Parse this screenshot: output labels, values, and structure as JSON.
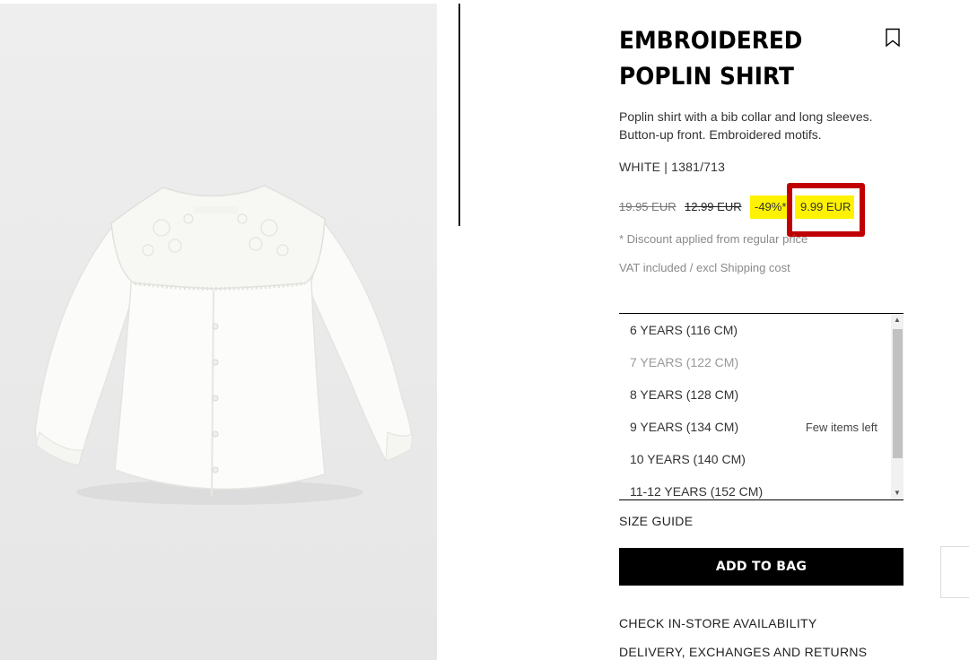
{
  "product": {
    "title_line1": "EMBROIDERED",
    "title_line2": "POPLIN SHIRT",
    "description_line1": "Poplin shirt with a bib collar and long sleeves.",
    "description_line2": "Button-up front. Embroidered motifs.",
    "color_ref": "WHITE | 1381/713"
  },
  "prices": {
    "original": "19.95 EUR",
    "previous": "12.99 EUR",
    "discount": "-49%*",
    "current": "9.99 EUR",
    "discount_note": "* Discount applied from regular price",
    "vat_note": "VAT included / excl Shipping cost"
  },
  "sizes": [
    {
      "label": "6 YEARS (116 CM)",
      "available": true,
      "note": ""
    },
    {
      "label": "7 YEARS (122 CM)",
      "available": false,
      "note": ""
    },
    {
      "label": "8 YEARS (128 CM)",
      "available": true,
      "note": ""
    },
    {
      "label": "9 YEARS (134 CM)",
      "available": true,
      "note": "Few items left"
    },
    {
      "label": "10 YEARS (140 CM)",
      "available": true,
      "note": ""
    },
    {
      "label": "11-12 YEARS (152 CM)",
      "available": true,
      "note": ""
    }
  ],
  "actions": {
    "size_guide": "SIZE GUIDE",
    "add_to_bag": "ADD TO BAG",
    "check_store": "CHECK IN-STORE AVAILABILITY",
    "delivery": "DELIVERY, EXCHANGES AND RETURNS"
  },
  "icons": {
    "bookmark": "bookmark-icon",
    "scroll_up": "scroll-up-arrow-icon",
    "scroll_down": "scroll-down-arrow-icon"
  },
  "colors": {
    "sale_highlight": "#fff200",
    "annotation_box": "#c00000",
    "button_bg": "#000000"
  }
}
